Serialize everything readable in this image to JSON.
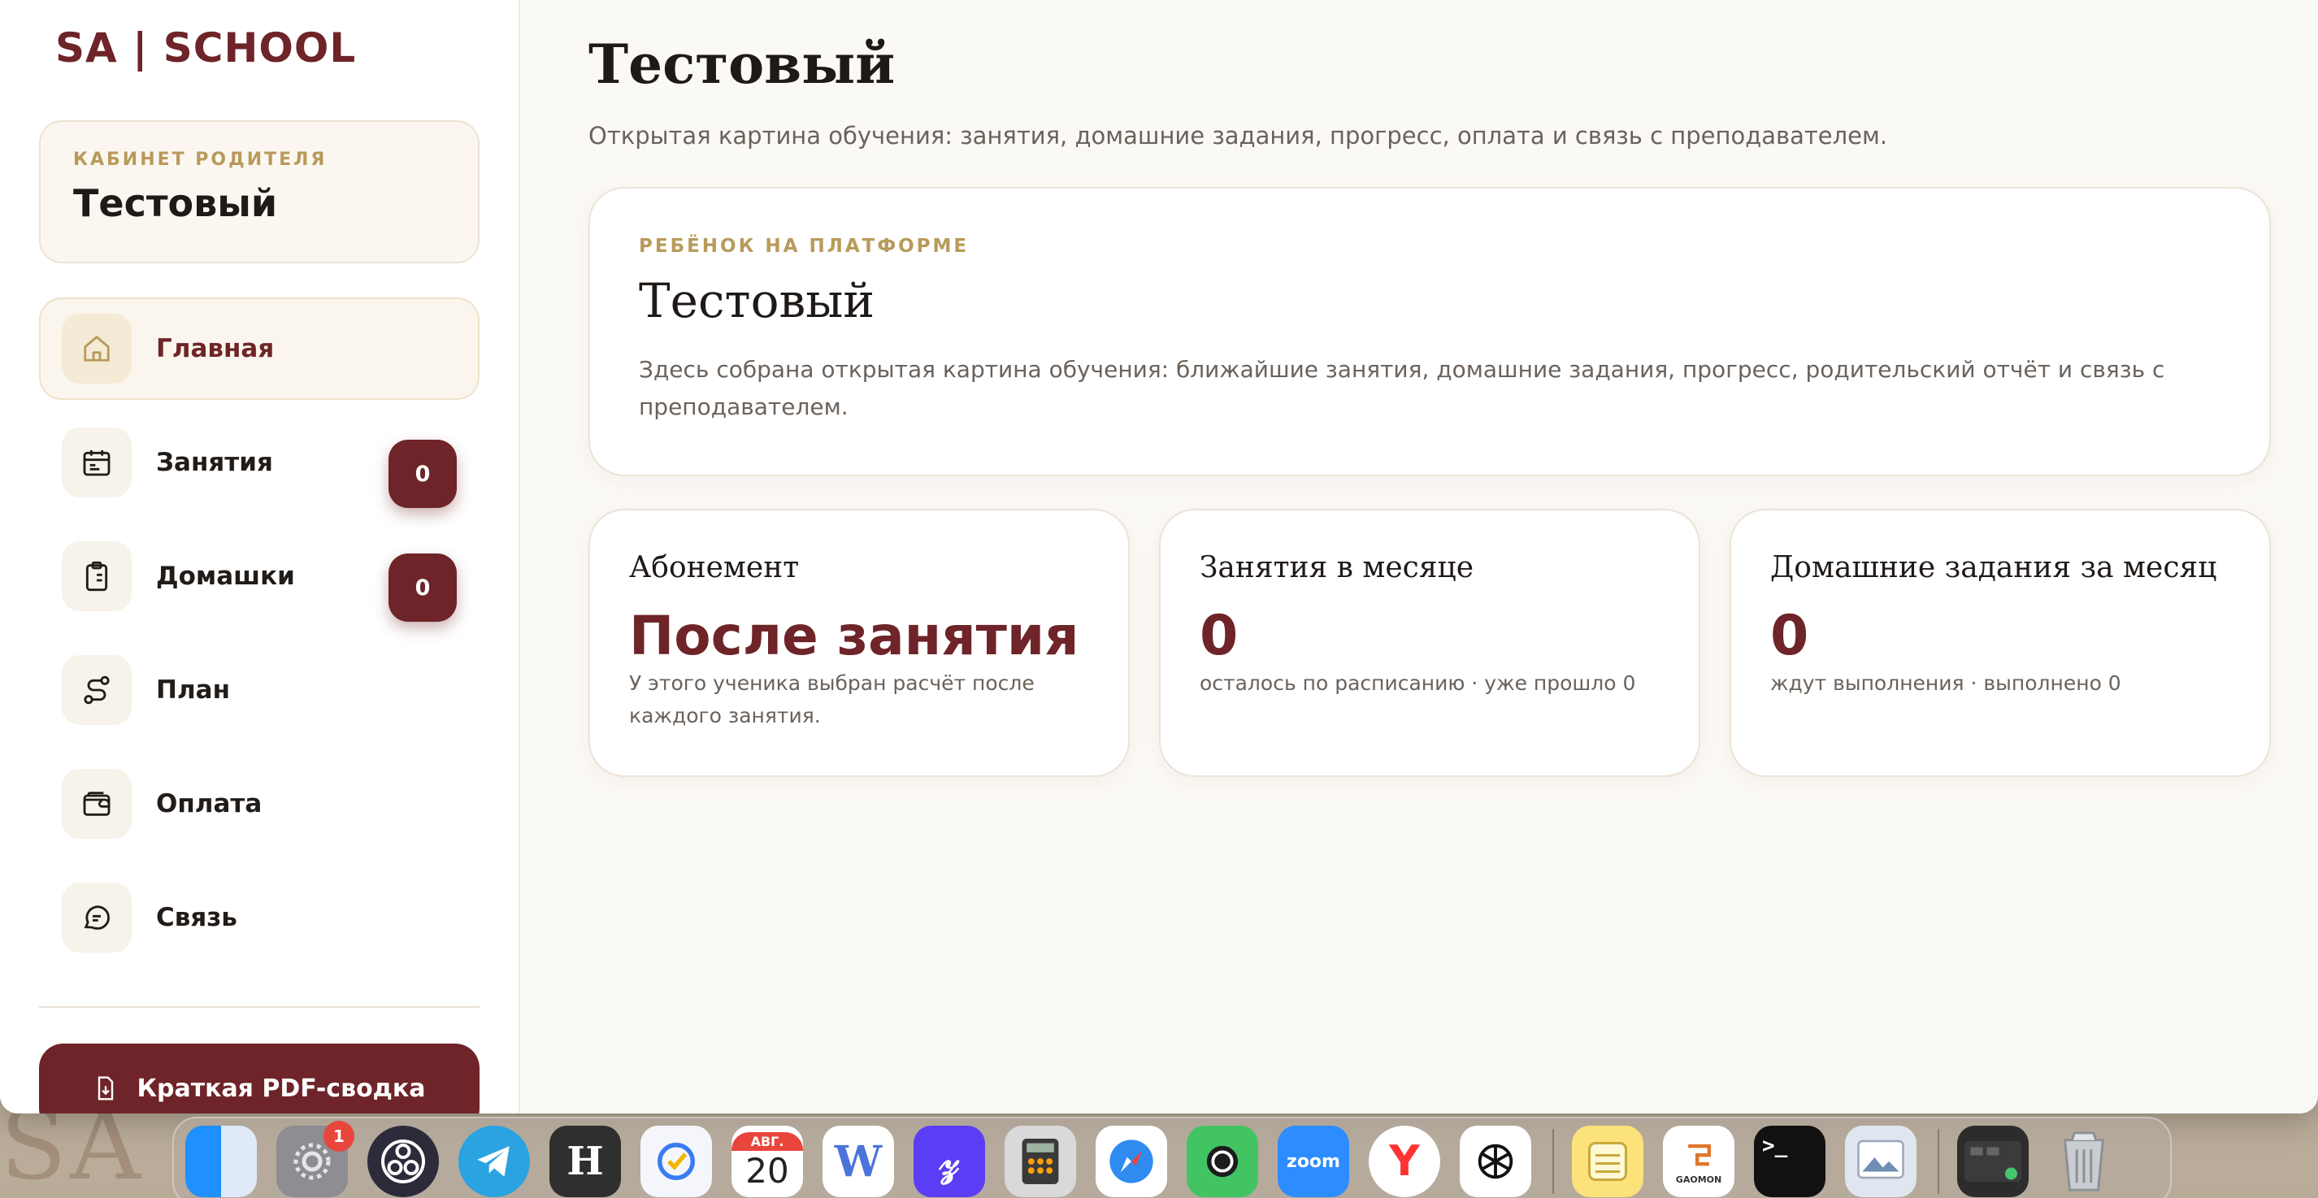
{
  "brand": "SA | SCHOOL",
  "parent_card": {
    "kicker": "КАБИНЕТ РОДИТЕЛЯ",
    "name": "Тестовый"
  },
  "nav": [
    {
      "label": "Главная",
      "icon": "home-icon",
      "active": true
    },
    {
      "label": "Занятия",
      "icon": "calendar-icon",
      "badge": "0"
    },
    {
      "label": "Домашки",
      "icon": "clipboard-icon",
      "badge": "0"
    },
    {
      "label": "План",
      "icon": "route-icon"
    },
    {
      "label": "Оплата",
      "icon": "wallet-icon"
    },
    {
      "label": "Связь",
      "icon": "chat-icon"
    }
  ],
  "pdf_button": "Краткая PDF-сводка",
  "page": {
    "title": "Тестовый",
    "subtitle": "Открытая картина обучения: занятия, домашние задания, прогресс, оплата и связь с преподавателем."
  },
  "hero": {
    "kicker": "РЕБЁНОК НА ПЛАТФОРМЕ",
    "title": "Тестовый",
    "desc": "Здесь собрана открытая картина обучения: ближайшие занятия, домашние задания, прогресс, родительский отчёт и связь с преподавателем."
  },
  "stats": [
    {
      "label": "Абонемент",
      "value": "После занятия",
      "note": "У этого ученика выбран расчёт после каждого занятия."
    },
    {
      "label": "Занятия в месяце",
      "value": "0",
      "note": "осталось по расписанию · уже прошло 0"
    },
    {
      "label": "Домашние задания за месяц",
      "value": "0",
      "note": "ждут выполнения · выполнено 0"
    }
  ],
  "dock": {
    "apps": [
      "finder",
      "system-settings",
      "obs",
      "telegram",
      "h-app",
      "tasks",
      "calendar",
      "word",
      "pen-app",
      "calculator",
      "safari",
      "vpn",
      "zoom",
      "yandex-browser",
      "chatgpt",
      "notes",
      "gaomon",
      "terminal",
      "preview",
      "screen",
      "trash"
    ],
    "calendar_month": "АВГ.",
    "calendar_day": "20",
    "settings_badge": "1",
    "zoom_label": "zoom",
    "gaomon_label": "GAOMON"
  },
  "desktop_watermark": "SA",
  "colors": {
    "accent": "#6e2428",
    "gold": "#b89a5a",
    "bg": "#fbf9f6"
  }
}
